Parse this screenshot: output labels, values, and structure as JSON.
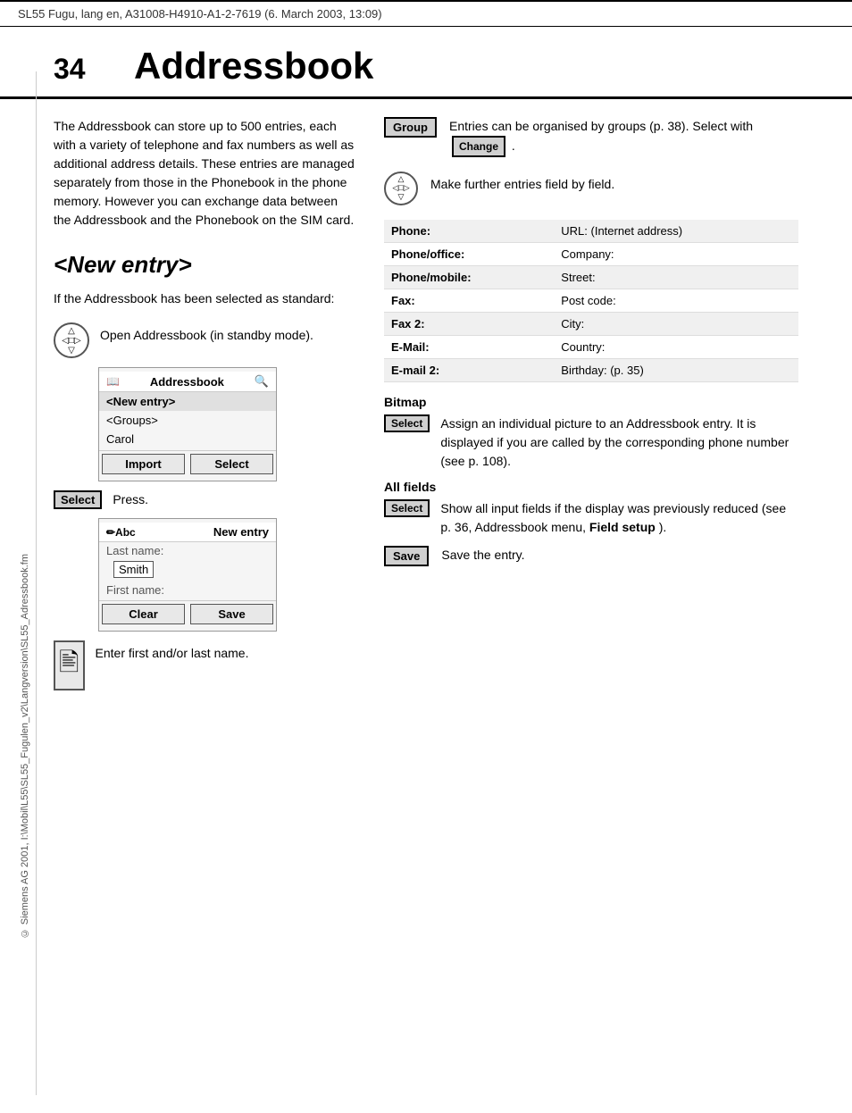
{
  "header": {
    "text": "SL55 Fugu, lang en, A31008-H4910-A1-2-7619 (6. March 2003, 13:09)"
  },
  "sidebar": {
    "copyright": "© Siemens AG 2001, I:\\Mobil\\L55\\SL55_Fugulen_v2\\Langversion\\SL55_Adressbook.fm"
  },
  "page": {
    "number": "34",
    "title": "Addressbook"
  },
  "intro": "The Addressbook can store up to 500 entries, each with a variety of telephone and fax numbers as well as additional address details. These entries are managed separately from those in the Phonebook in the phone memory. However you can exchange data between the Addressbook and the Phonebook on the SIM card.",
  "new_entry_section": {
    "heading": "<New entry>",
    "desc": "If the Addressbook has been selected as standard:",
    "open_desc": "Open Addressbook (in standby mode).",
    "phone_ui": {
      "title": "Addressbook",
      "items": [
        "<New entry>",
        "<Groups>",
        "Carol"
      ],
      "buttons": [
        "Import",
        "Select"
      ]
    },
    "select_label": "Select",
    "press_text": "Press.",
    "form_ui": {
      "title": "New entry",
      "title_icon": "✏Abc",
      "last_name_label": "Last name:",
      "last_name_value": "Smith",
      "first_name_label": "First name:",
      "buttons": [
        "Clear",
        "Save"
      ]
    },
    "enter_name_text": "Enter first and/or last name."
  },
  "right_column": {
    "group_section": {
      "label": "Group",
      "desc_before": "Entries can be organised by groups (p. 38). Select with",
      "change_badge": "Change",
      "desc_after": "."
    },
    "nav_desc": "Make further entries field by field.",
    "field_table": [
      {
        "left": "Phone:",
        "right": "URL: (Internet address)"
      },
      {
        "left": "Phone/office:",
        "right": "Company:"
      },
      {
        "left": "Phone/mobile:",
        "right": "Street:"
      },
      {
        "left": "Fax:",
        "right": "Post code:"
      },
      {
        "left": "Fax 2:",
        "right": "City:"
      },
      {
        "left": "E-Mail:",
        "right": "Country:"
      },
      {
        "left": "E-mail 2:",
        "right": "Birthday: (p. 35)"
      }
    ],
    "bitmap_section": {
      "label": "Bitmap",
      "select_badge": "Select",
      "desc": "Assign an individual picture to an Addressbook entry. It is displayed if you are called by the corresponding phone number (see p. 108)."
    },
    "allfields_section": {
      "label": "All fields",
      "select_badge": "Select",
      "desc": "Show all input fields if the display was previously reduced (see p. 36, Addressbook menu,",
      "field_setup": "Field setup",
      "desc_end": ")."
    },
    "save_section": {
      "badge": "Save",
      "desc": "Save the entry."
    }
  }
}
